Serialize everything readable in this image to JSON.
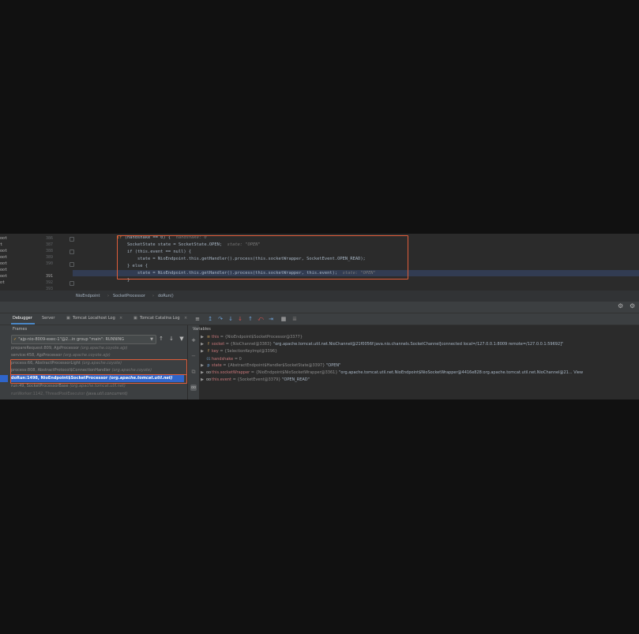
{
  "editor": {
    "left_strip": [
      "oot",
      "t",
      "oot",
      "oot",
      "oot",
      "oot",
      "oot",
      "ot"
    ],
    "line_numbers": [
      "386",
      "387",
      "388",
      "389",
      "390",
      "391",
      "392",
      "393"
    ],
    "current_line": "391",
    "code": [
      {
        "t": "if (handshake == 0) {",
        "hint": "handshake: 0"
      },
      {
        "t": "    SocketState state = SocketState.OPEN;",
        "hint": "state: \"OPEN\""
      },
      {
        "t": "    if (this.event == null) {",
        "hint": ""
      },
      {
        "t": "        state = NioEndpoint.this.getHandler().process(this.socketWrapper, SocketEvent.OPEN_READ);",
        "hint": ""
      },
      {
        "t": "    } else {",
        "hint": ""
      },
      {
        "t": "        state = NioEndpoint.this.getHandler().process(this.socketWrapper, this.event);",
        "hint": "state: \"OPEN\""
      },
      {
        "t": "    }",
        "hint": ""
      },
      {
        "t": "",
        "hint": ""
      }
    ],
    "breadcrumbs": [
      "NioEndpoint",
      "SocketProcessor",
      "doRun()"
    ]
  },
  "debug": {
    "tabs": [
      "Debugger",
      "Server",
      "Tomcat Localhost Log",
      "Tomcat Catalina Log"
    ],
    "frames_title": "Frames",
    "variables_title": "Variables",
    "thread": "\"ajp-nio-8009-exec-1\"@2...in group \"main\": RUNNING",
    "frames": [
      {
        "method": "prepareRequest:809, AjpProcessor",
        "pkg": "(org.apache.coyote.ajp)",
        "state": "normal"
      },
      {
        "method": "service:458, AjpProcessor",
        "pkg": "(org.apache.coyote.ajp)",
        "state": "normal"
      },
      {
        "method": "process:66, AbstractProcessorLight",
        "pkg": "(org.apache.coyote)",
        "state": "normal"
      },
      {
        "method": "process:808, AbstractProtocol$ConnectionHandler",
        "pkg": "(org.apache.coyote)",
        "state": "normal"
      },
      {
        "method": "doRun:1498, NioEndpoint$SocketProcessor",
        "pkg": "(org.apache.tomcat.util.net)",
        "state": "selected"
      },
      {
        "method": "run:49, SocketProcessorBase",
        "pkg": "(org.apache.tomcat.util.net)",
        "state": "normal"
      },
      {
        "method": "runWorker:1142, ThreadPoolExecutor",
        "pkg": "(java.util.concurrent)",
        "state": "faded"
      }
    ],
    "variables": [
      {
        "expand": "▶",
        "icon": "≡",
        "name": "this",
        "type": "= {NioEndpoint$SocketProcessor@3377}",
        "val": ""
      },
      {
        "expand": "▶",
        "icon": "f",
        "name": "socket",
        "type": "= {NioChannel@3383}",
        "val": "\"org.apache.tomcat.util.net.NioChannel@21f0056f:java.nio.channels.SocketChannel[connected local=/127.0.0.1:8009 remote=/127.0.0.1:59692]\""
      },
      {
        "expand": "▶",
        "icon": "f",
        "name": "key",
        "type": "= {SelectionKeyImpl@3396}",
        "val": ""
      },
      {
        "expand": "",
        "icon": "01",
        "name": "handshake",
        "type": "= 0",
        "val": ""
      },
      {
        "expand": "▶",
        "icon": "p",
        "name": "state",
        "type": "= {AbstractEndpoint$Handler$SocketState@3397}",
        "val": "\"OPEN\""
      },
      {
        "expand": "▶",
        "icon": "oo",
        "name": "this.socketWrapper",
        "type": "= {NioEndpoint$NioSocketWrapper@3361}",
        "val": "\"org.apache.tomcat.util.net.NioEndpoint$NioSocketWrapper@4416e828:org.apache.tomcat.util.net.NioChannel@21... View"
      },
      {
        "expand": "▶",
        "icon": "oo",
        "name": "this.event",
        "type": "= {SocketEvent@3379}",
        "val": "\"OPEN_READ\""
      }
    ]
  },
  "colors": {
    "highlight_box": "#e05d3a",
    "selection": "#2f65ca",
    "editor_bg": "#2b2b2b",
    "panel_bg": "#3c3f41"
  }
}
